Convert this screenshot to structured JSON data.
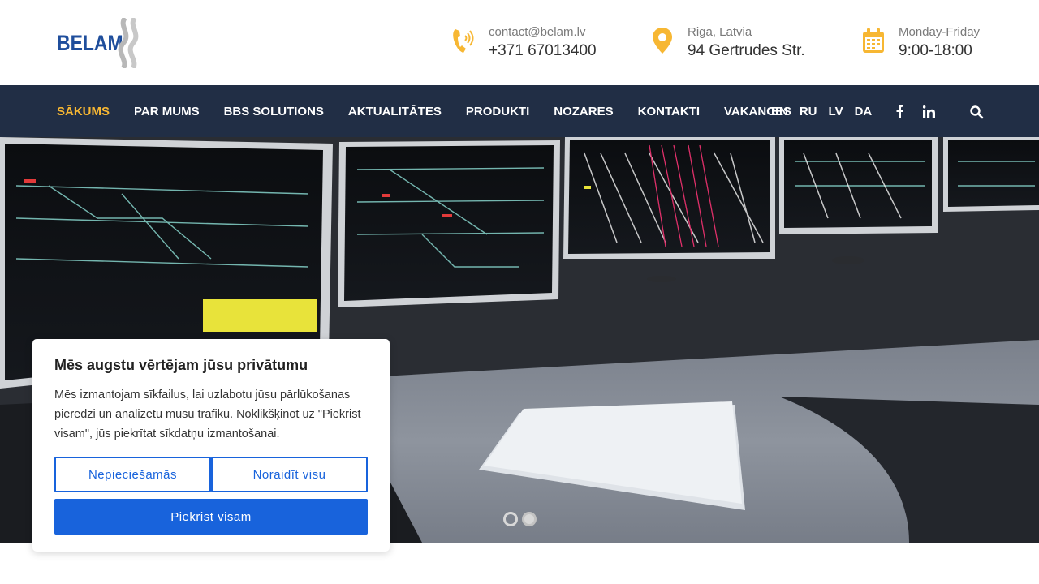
{
  "brand": {
    "logo_text": "BELAM"
  },
  "contacts": [
    {
      "icon": "phone-icon",
      "small": "contact@belam.lv",
      "big": "+371 67013400"
    },
    {
      "icon": "map-pin-icon",
      "small": "Riga, Latvia",
      "big": "94 Gertrudes Str."
    },
    {
      "icon": "calendar-icon",
      "small": "Monday-Friday",
      "big": "9:00-18:00"
    }
  ],
  "nav": {
    "items": [
      "SĀKUMS",
      "PAR MUMS",
      "BBS SOLUTIONS",
      "AKTUALITĀTES",
      "PRODUKTI",
      "NOZARES",
      "KONTAKTI",
      "VAKANCES"
    ],
    "languages": [
      "EN",
      "RU",
      "LV",
      "DA"
    ]
  },
  "slider": {
    "slides": 2,
    "active_index": 0
  },
  "cookie": {
    "title": "Mēs augstu vērtējam jūsu privātumu",
    "text": "Mēs izmantojam sīkfailus, lai uzlabotu jūsu pārlūkošanas pieredzi un analizētu mūsu trafiku. Noklikšķinot uz \"Piekrist visam\", jūs piekrītat sīkdatņu izmantošanai.",
    "btn_necessary": "Nepieciešamās",
    "btn_reject": "Noraidīt visu",
    "btn_accept": "Piekrist visam"
  },
  "colors": {
    "accent": "#f7b733",
    "nav_bg": "#212e45",
    "cookie_blue": "#1863dc",
    "logo_blue": "#1f4e9c"
  }
}
